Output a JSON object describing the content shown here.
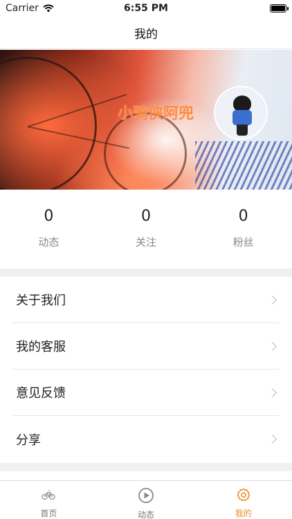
{
  "status_bar": {
    "carrier": "Carrier",
    "time": "6:55 PM"
  },
  "nav": {
    "title": "我的"
  },
  "profile": {
    "banner_text": "小骑侠阿兜"
  },
  "stats": [
    {
      "value": "0",
      "label": "动态"
    },
    {
      "value": "0",
      "label": "关注"
    },
    {
      "value": "0",
      "label": "粉丝"
    }
  ],
  "menu": [
    {
      "label": "关于我们"
    },
    {
      "label": "我的客服"
    },
    {
      "label": "意见反馈"
    },
    {
      "label": "分享"
    }
  ],
  "tabs": [
    {
      "label": "首页",
      "icon": "bicycle-icon",
      "active": false
    },
    {
      "label": "动态",
      "icon": "play-circle-icon",
      "active": false
    },
    {
      "label": "我的",
      "icon": "gear-icon",
      "active": true
    }
  ],
  "colors": {
    "accent": "#f08a1c",
    "banner_text": "#ff8a3d"
  }
}
